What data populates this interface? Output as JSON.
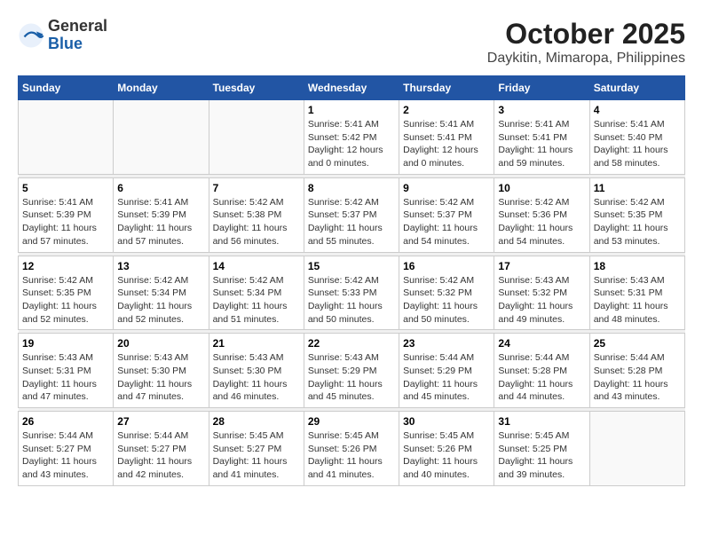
{
  "logo": {
    "general": "General",
    "blue": "Blue"
  },
  "title": "October 2025",
  "subtitle": "Daykitin, Mimaropa, Philippines",
  "days_of_week": [
    "Sunday",
    "Monday",
    "Tuesday",
    "Wednesday",
    "Thursday",
    "Friday",
    "Saturday"
  ],
  "weeks": [
    [
      {
        "day": "",
        "info": ""
      },
      {
        "day": "",
        "info": ""
      },
      {
        "day": "",
        "info": ""
      },
      {
        "day": "1",
        "info": "Sunrise: 5:41 AM\nSunset: 5:42 PM\nDaylight: 12 hours\nand 0 minutes."
      },
      {
        "day": "2",
        "info": "Sunrise: 5:41 AM\nSunset: 5:41 PM\nDaylight: 12 hours\nand 0 minutes."
      },
      {
        "day": "3",
        "info": "Sunrise: 5:41 AM\nSunset: 5:41 PM\nDaylight: 11 hours\nand 59 minutes."
      },
      {
        "day": "4",
        "info": "Sunrise: 5:41 AM\nSunset: 5:40 PM\nDaylight: 11 hours\nand 58 minutes."
      }
    ],
    [
      {
        "day": "5",
        "info": "Sunrise: 5:41 AM\nSunset: 5:39 PM\nDaylight: 11 hours\nand 57 minutes."
      },
      {
        "day": "6",
        "info": "Sunrise: 5:41 AM\nSunset: 5:39 PM\nDaylight: 11 hours\nand 57 minutes."
      },
      {
        "day": "7",
        "info": "Sunrise: 5:42 AM\nSunset: 5:38 PM\nDaylight: 11 hours\nand 56 minutes."
      },
      {
        "day": "8",
        "info": "Sunrise: 5:42 AM\nSunset: 5:37 PM\nDaylight: 11 hours\nand 55 minutes."
      },
      {
        "day": "9",
        "info": "Sunrise: 5:42 AM\nSunset: 5:37 PM\nDaylight: 11 hours\nand 54 minutes."
      },
      {
        "day": "10",
        "info": "Sunrise: 5:42 AM\nSunset: 5:36 PM\nDaylight: 11 hours\nand 54 minutes."
      },
      {
        "day": "11",
        "info": "Sunrise: 5:42 AM\nSunset: 5:35 PM\nDaylight: 11 hours\nand 53 minutes."
      }
    ],
    [
      {
        "day": "12",
        "info": "Sunrise: 5:42 AM\nSunset: 5:35 PM\nDaylight: 11 hours\nand 52 minutes."
      },
      {
        "day": "13",
        "info": "Sunrise: 5:42 AM\nSunset: 5:34 PM\nDaylight: 11 hours\nand 52 minutes."
      },
      {
        "day": "14",
        "info": "Sunrise: 5:42 AM\nSunset: 5:34 PM\nDaylight: 11 hours\nand 51 minutes."
      },
      {
        "day": "15",
        "info": "Sunrise: 5:42 AM\nSunset: 5:33 PM\nDaylight: 11 hours\nand 50 minutes."
      },
      {
        "day": "16",
        "info": "Sunrise: 5:42 AM\nSunset: 5:32 PM\nDaylight: 11 hours\nand 50 minutes."
      },
      {
        "day": "17",
        "info": "Sunrise: 5:43 AM\nSunset: 5:32 PM\nDaylight: 11 hours\nand 49 minutes."
      },
      {
        "day": "18",
        "info": "Sunrise: 5:43 AM\nSunset: 5:31 PM\nDaylight: 11 hours\nand 48 minutes."
      }
    ],
    [
      {
        "day": "19",
        "info": "Sunrise: 5:43 AM\nSunset: 5:31 PM\nDaylight: 11 hours\nand 47 minutes."
      },
      {
        "day": "20",
        "info": "Sunrise: 5:43 AM\nSunset: 5:30 PM\nDaylight: 11 hours\nand 47 minutes."
      },
      {
        "day": "21",
        "info": "Sunrise: 5:43 AM\nSunset: 5:30 PM\nDaylight: 11 hours\nand 46 minutes."
      },
      {
        "day": "22",
        "info": "Sunrise: 5:43 AM\nSunset: 5:29 PM\nDaylight: 11 hours\nand 45 minutes."
      },
      {
        "day": "23",
        "info": "Sunrise: 5:44 AM\nSunset: 5:29 PM\nDaylight: 11 hours\nand 45 minutes."
      },
      {
        "day": "24",
        "info": "Sunrise: 5:44 AM\nSunset: 5:28 PM\nDaylight: 11 hours\nand 44 minutes."
      },
      {
        "day": "25",
        "info": "Sunrise: 5:44 AM\nSunset: 5:28 PM\nDaylight: 11 hours\nand 43 minutes."
      }
    ],
    [
      {
        "day": "26",
        "info": "Sunrise: 5:44 AM\nSunset: 5:27 PM\nDaylight: 11 hours\nand 43 minutes."
      },
      {
        "day": "27",
        "info": "Sunrise: 5:44 AM\nSunset: 5:27 PM\nDaylight: 11 hours\nand 42 minutes."
      },
      {
        "day": "28",
        "info": "Sunrise: 5:45 AM\nSunset: 5:27 PM\nDaylight: 11 hours\nand 41 minutes."
      },
      {
        "day": "29",
        "info": "Sunrise: 5:45 AM\nSunset: 5:26 PM\nDaylight: 11 hours\nand 41 minutes."
      },
      {
        "day": "30",
        "info": "Sunrise: 5:45 AM\nSunset: 5:26 PM\nDaylight: 11 hours\nand 40 minutes."
      },
      {
        "day": "31",
        "info": "Sunrise: 5:45 AM\nSunset: 5:25 PM\nDaylight: 11 hours\nand 39 minutes."
      },
      {
        "day": "",
        "info": ""
      }
    ]
  ]
}
